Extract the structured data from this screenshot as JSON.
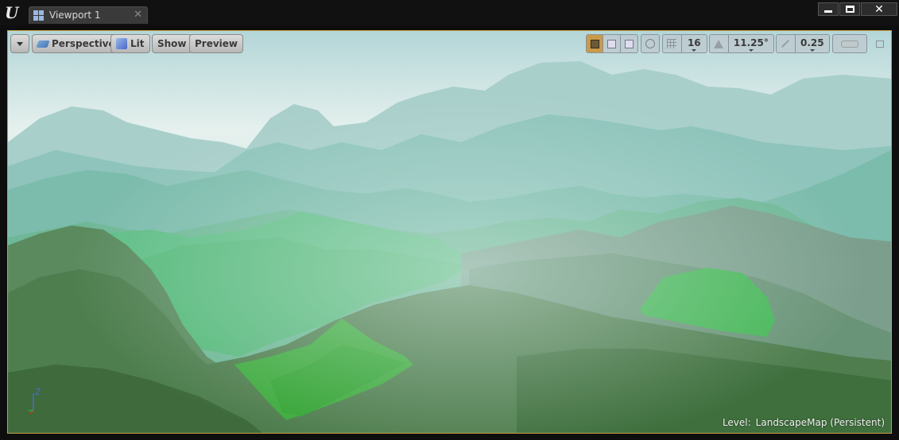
{
  "window": {
    "tab_label": "Viewport 1",
    "tab_close": "✕",
    "close_glyph": "✕"
  },
  "toolbar": {
    "dropdown_icon": "chevron-down-icon",
    "perspective_label": "Perspective",
    "lit_label": "Lit",
    "show_label": "Show",
    "preview_label": "Preview",
    "grid_snap_value": "16",
    "rotation_snap_value": "11.25°",
    "scale_snap_value": "0.25"
  },
  "status": {
    "level_label": "Level:",
    "level_value": "LandscapeMap (Persistent)"
  },
  "axis": {
    "z_label": "Z"
  },
  "colors": {
    "viewport_border": "#c8a040",
    "sky_top": "#b8d8dc",
    "grass_bright": "#3fae3f"
  }
}
